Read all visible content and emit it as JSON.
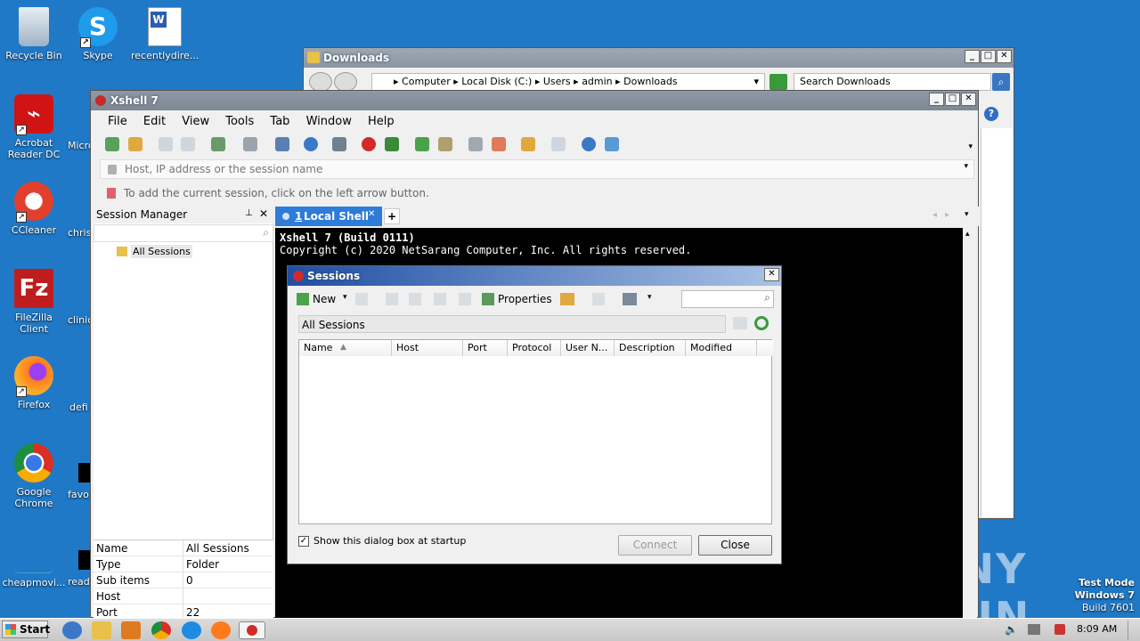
{
  "desktop": {
    "icons": [
      {
        "label": "Recycle Bin",
        "color": "#d0d8e0"
      },
      {
        "label": "Skype",
        "color": "#1e9bea"
      },
      {
        "label": "recentlydire...",
        "color": "#2b5eb3"
      },
      {
        "label": "Acrobat Reader DC",
        "color": "#d01414"
      },
      {
        "label": "CCleaner",
        "color": "#e2402d"
      },
      {
        "label": "FileZilla Client",
        "color": "#bf1d1d"
      },
      {
        "label": "Firefox",
        "color": "#ff7b1c"
      },
      {
        "label": "Google Chrome",
        "color": "#2b9c46"
      },
      {
        "label": "cheapmovi...",
        "color": "#1f79c7"
      }
    ],
    "partial_labels": [
      "Micro",
      "chris",
      "clinic",
      "defi",
      "favo",
      "read"
    ],
    "watermark": {
      "brand": "ANY RUN",
      "mode": "Test Mode",
      "os": "Windows 7",
      "build": "Build 7601"
    }
  },
  "downloads": {
    "title": "Downloads",
    "breadcrumb": [
      "Computer",
      "Local Disk (C:)",
      "Users",
      "admin",
      "Downloads"
    ],
    "search_placeholder": "Search Downloads"
  },
  "xshell": {
    "title": "Xshell 7",
    "menu": [
      "File",
      "Edit",
      "View",
      "Tools",
      "Tab",
      "Window",
      "Help"
    ],
    "address_placeholder": "Host, IP address or the session name",
    "hint": "To add the current session, click on the left arrow button.",
    "session_manager": {
      "title": "Session Manager",
      "tree_root": "All Sessions",
      "properties": [
        {
          "name": "Name",
          "value": "All Sessions"
        },
        {
          "name": "Type",
          "value": "Folder"
        },
        {
          "name": "Sub items",
          "value": "0"
        },
        {
          "name": "Host",
          "value": ""
        },
        {
          "name": "Port",
          "value": "22"
        }
      ]
    },
    "tab": {
      "number": "1",
      "label": "Local Shell"
    },
    "terminal": {
      "line1": "Xshell 7 (Build 0111)",
      "line2": "Copyright (c) 2020 NetSarang Computer, Inc. All rights reserved."
    }
  },
  "sessions_dialog": {
    "title": "Sessions",
    "toolbar": {
      "new_label": "New",
      "properties_label": "Properties"
    },
    "path": "All Sessions",
    "columns": [
      "Name",
      "Host",
      "Port",
      "Protocol",
      "User N...",
      "Description",
      "Modified"
    ],
    "startup_checkbox": {
      "label": "Show this dialog box at startup",
      "checked": true
    },
    "connect_label": "Connect",
    "close_label": "Close"
  },
  "taskbar": {
    "start_label": "Start",
    "time": "8:09 AM"
  }
}
